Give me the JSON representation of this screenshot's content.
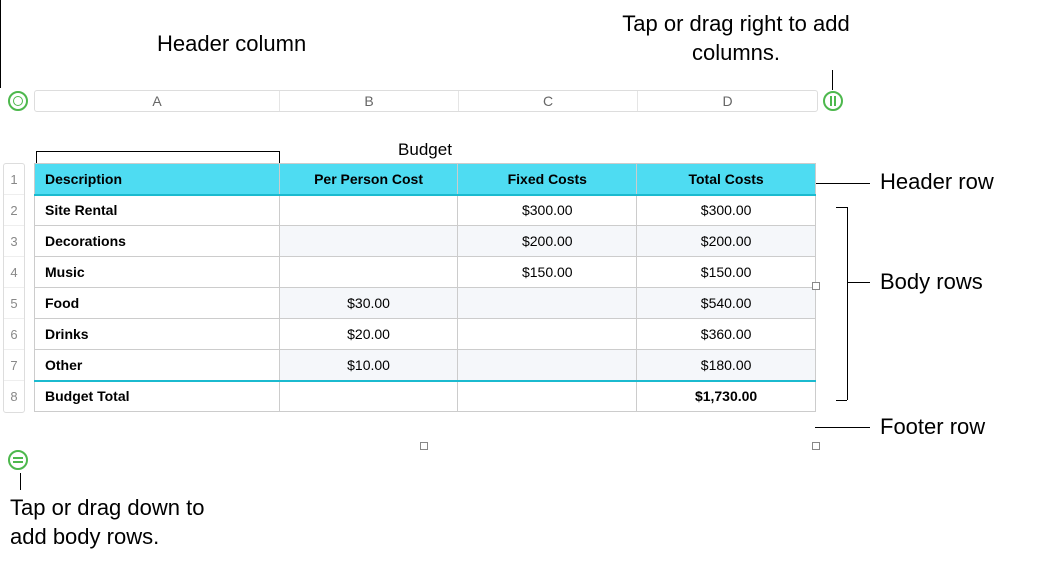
{
  "callouts": {
    "header_column": "Header column",
    "add_columns": "Tap or drag right to add columns.",
    "header_row": "Header row",
    "body_rows": "Body rows",
    "footer_row": "Footer row",
    "add_rows": "Tap or drag down to add body rows."
  },
  "table": {
    "title": "Budget",
    "column_letters": [
      "A",
      "B",
      "C",
      "D"
    ],
    "row_numbers": [
      "1",
      "2",
      "3",
      "4",
      "5",
      "6",
      "7",
      "8"
    ],
    "headers": {
      "description": "Description",
      "per_person_cost": "Per Person Cost",
      "fixed_costs": "Fixed Costs",
      "total_costs": "Total Costs"
    },
    "rows": [
      {
        "description": "Site Rental",
        "per_person": "",
        "fixed": "$300.00",
        "total": "$300.00"
      },
      {
        "description": "Decorations",
        "per_person": "",
        "fixed": "$200.00",
        "total": "$200.00"
      },
      {
        "description": "Music",
        "per_person": "",
        "fixed": "$150.00",
        "total": "$150.00"
      },
      {
        "description": "Food",
        "per_person": "$30.00",
        "fixed": "",
        "total": "$540.00"
      },
      {
        "description": "Drinks",
        "per_person": "$20.00",
        "fixed": "",
        "total": "$360.00"
      },
      {
        "description": "Other",
        "per_person": "$10.00",
        "fixed": "",
        "total": "$180.00"
      }
    ],
    "footer": {
      "description": "Budget Total",
      "per_person": "",
      "fixed": "",
      "total": "$1,730.00"
    }
  },
  "colors": {
    "header_bg": "#4edcf2",
    "accent": "#4db84d"
  }
}
